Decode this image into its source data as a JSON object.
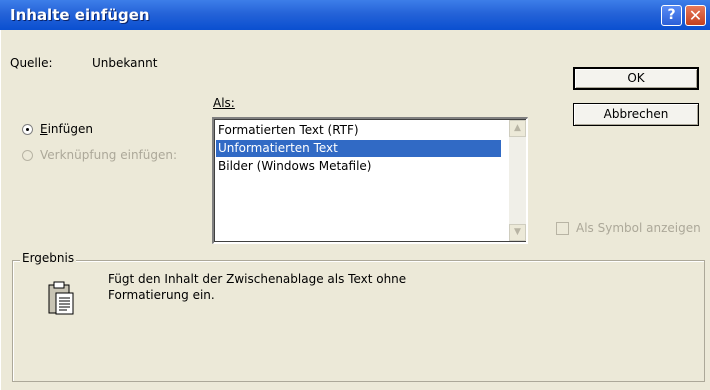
{
  "window": {
    "title": "Inhalte einfügen",
    "help_glyph": "?",
    "close_glyph": "✕"
  },
  "source": {
    "label": "Quelle:",
    "value": "Unbekannt"
  },
  "as_label": "Als:",
  "options": {
    "paste": {
      "accel": "E",
      "rest": "infügen",
      "checked": true
    },
    "link": {
      "label": "Verknüpfung einfügen:",
      "checked": false,
      "enabled": false
    }
  },
  "format_list": {
    "items": [
      {
        "label": "Formatierten Text (RTF)",
        "selected": false
      },
      {
        "label": "Unformatierten Text",
        "selected": true
      },
      {
        "label": "Bilder (Windows Metafile)",
        "selected": false
      }
    ]
  },
  "buttons": {
    "ok": "OK",
    "cancel": "Abbrechen"
  },
  "symbol_checkbox": {
    "label": "Als Symbol anzeigen",
    "checked": false,
    "enabled": false
  },
  "result": {
    "label": "Ergebnis",
    "text_line1": "Fügt den Inhalt der Zwischenablage als Text ohne",
    "text_line2": "Formatierung ein.",
    "icon": "clipboard-icon"
  },
  "colors": {
    "title_bar": "#0a4fd0",
    "selection": "#316ac5",
    "dialog_bg": "#ece9d8"
  }
}
